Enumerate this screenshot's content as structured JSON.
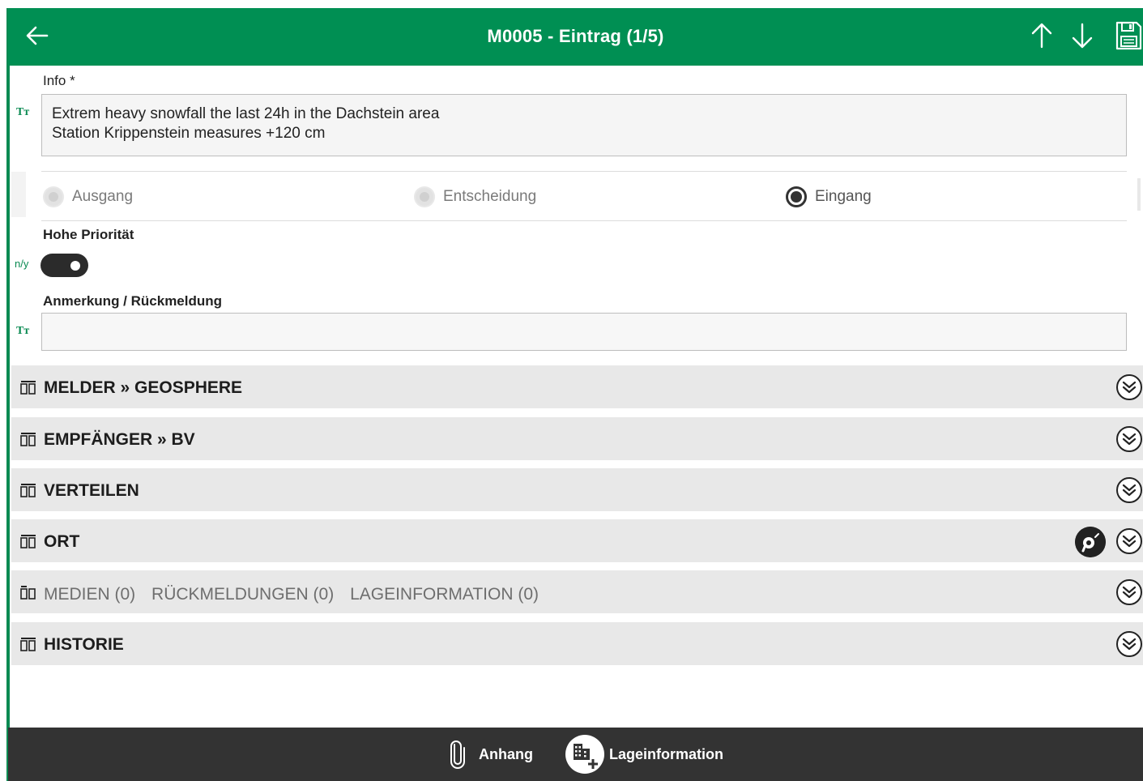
{
  "header": {
    "title": "M0005 - Eintrag  (1/5)"
  },
  "info": {
    "label": "Info *",
    "lines": [
      "Extrem heavy snowfall the last 24h in the Dachstein area",
      "Station Krippenstein measures +120 cm"
    ],
    "type_icon": "Tт"
  },
  "direction": {
    "options": [
      {
        "label": "Ausgang",
        "selected": false
      },
      {
        "label": "Entscheidung",
        "selected": false
      },
      {
        "label": "Eingang",
        "selected": true
      }
    ]
  },
  "priority": {
    "label": "Hohe Priorität",
    "prefix": "n/y",
    "value": true
  },
  "remark": {
    "label": "Anmerkung / Rückmeldung",
    "value": "",
    "type_icon": "Tт"
  },
  "sections": [
    {
      "title": "MELDER » GEOSPHERE"
    },
    {
      "title": "EMPFÄNGER » BV"
    },
    {
      "title": "VERTEILEN"
    },
    {
      "title": "ORT"
    },
    {
      "parts": [
        "MEDIEN (0)",
        "RÜCKMELDUNGEN (0)",
        "LAGEINFORMATION (0)"
      ]
    },
    {
      "title": "HISTORIE"
    }
  ],
  "footer": {
    "attachment_label": "Anhang",
    "lage_label": "Lageinformation"
  },
  "colors": {
    "primary": "#008f53",
    "footer": "#333333",
    "section_bg": "#e8e8e8"
  },
  "icons": {
    "back": "arrow-left-icon",
    "up": "arrow-up-icon",
    "down": "arrow-down-icon",
    "save": "floppy-disk-icon",
    "section": "columns-icon",
    "expand": "double-chevron-down-icon",
    "location": "map-pin-icon",
    "attach": "paperclip-icon",
    "lage": "building-plus-icon"
  }
}
